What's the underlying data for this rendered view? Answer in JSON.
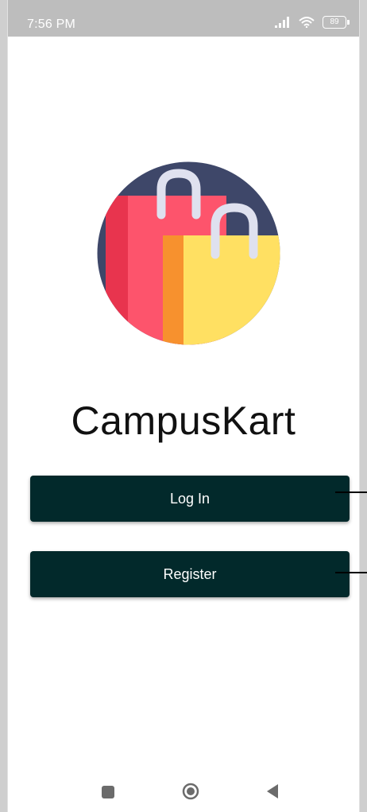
{
  "status_bar": {
    "time": "7:56 PM",
    "battery": "89"
  },
  "app": {
    "title": "CampusKart"
  },
  "buttons": {
    "login": "Log In",
    "register": "Register"
  },
  "colors": {
    "button_bg": "#02292b",
    "logo_circle": "#3e4769",
    "bag_red": "#fd546c",
    "bag_red_dark": "#e8344e",
    "bag_yellow": "#ffe062",
    "bag_orange": "#f7912e",
    "handle": "#dfe1ef"
  },
  "icons": [
    "signal-icon",
    "wifi-icon",
    "battery-icon",
    "shopping-bags-logo",
    "recent-apps-icon",
    "home-icon",
    "back-icon"
  ]
}
